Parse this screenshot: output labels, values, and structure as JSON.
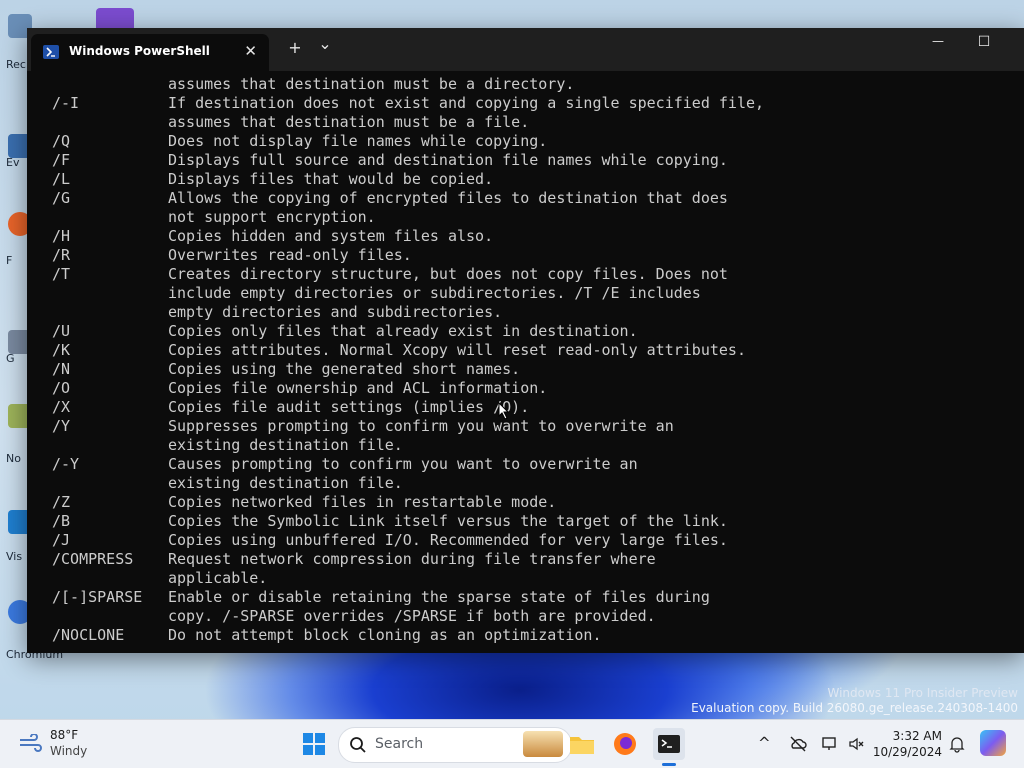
{
  "desktop": {
    "icon_labels": [
      "Rec",
      "Ev",
      "F",
      "G",
      "No",
      "Vis",
      "Chromium"
    ],
    "watermark": {
      "line1": "Windows 11 Pro Insider Preview",
      "line2": "Evaluation copy. Build 26080.ge_release.240308-1400"
    }
  },
  "window": {
    "tab_title": "Windows PowerShell",
    "tab_close": "✕",
    "new_tab": "+",
    "dropdown": "⌄",
    "minimize": "—",
    "maximize": "☐"
  },
  "terminal": {
    "lines": [
      {
        "sw": "",
        "desc": "assumes that destination must be a directory."
      },
      {
        "sw": "/-I",
        "desc": "If destination does not exist and copying a single specified file,"
      },
      {
        "sw": "",
        "desc": "assumes that destination must be a file."
      },
      {
        "sw": "/Q",
        "desc": "Does not display file names while copying."
      },
      {
        "sw": "/F",
        "desc": "Displays full source and destination file names while copying."
      },
      {
        "sw": "/L",
        "desc": "Displays files that would be copied."
      },
      {
        "sw": "/G",
        "desc": "Allows the copying of encrypted files to destination that does"
      },
      {
        "sw": "",
        "desc": "not support encryption."
      },
      {
        "sw": "/H",
        "desc": "Copies hidden and system files also."
      },
      {
        "sw": "/R",
        "desc": "Overwrites read-only files."
      },
      {
        "sw": "/T",
        "desc": "Creates directory structure, but does not copy files. Does not"
      },
      {
        "sw": "",
        "desc": "include empty directories or subdirectories. /T /E includes"
      },
      {
        "sw": "",
        "desc": "empty directories and subdirectories."
      },
      {
        "sw": "/U",
        "desc": "Copies only files that already exist in destination."
      },
      {
        "sw": "/K",
        "desc": "Copies attributes. Normal Xcopy will reset read-only attributes."
      },
      {
        "sw": "/N",
        "desc": "Copies using the generated short names."
      },
      {
        "sw": "/O",
        "desc": "Copies file ownership and ACL information."
      },
      {
        "sw": "/X",
        "desc": "Copies file audit settings (implies /O)."
      },
      {
        "sw": "/Y",
        "desc": "Suppresses prompting to confirm you want to overwrite an"
      },
      {
        "sw": "",
        "desc": "existing destination file."
      },
      {
        "sw": "/-Y",
        "desc": "Causes prompting to confirm you want to overwrite an"
      },
      {
        "sw": "",
        "desc": "existing destination file."
      },
      {
        "sw": "/Z",
        "desc": "Copies networked files in restartable mode."
      },
      {
        "sw": "/B",
        "desc": "Copies the Symbolic Link itself versus the target of the link."
      },
      {
        "sw": "/J",
        "desc": "Copies using unbuffered I/O. Recommended for very large files."
      },
      {
        "sw": "/COMPRESS",
        "desc": "Request network compression during file transfer where"
      },
      {
        "sw": "",
        "desc": "applicable."
      },
      {
        "sw": "/[-]SPARSE",
        "desc": "Enable or disable retaining the sparse state of files during"
      },
      {
        "sw": "",
        "desc": "copy. /-SPARSE overrides /SPARSE if both are provided."
      },
      {
        "sw": "/NOCLONE",
        "desc": "Do not attempt block cloning as an optimization."
      }
    ]
  },
  "taskbar": {
    "weather_temp": "88°F",
    "weather_cond": "Windy",
    "search_placeholder": "Search",
    "time": "3:32 AM",
    "date": "10/29/2024",
    "tray_chevron": "^"
  }
}
